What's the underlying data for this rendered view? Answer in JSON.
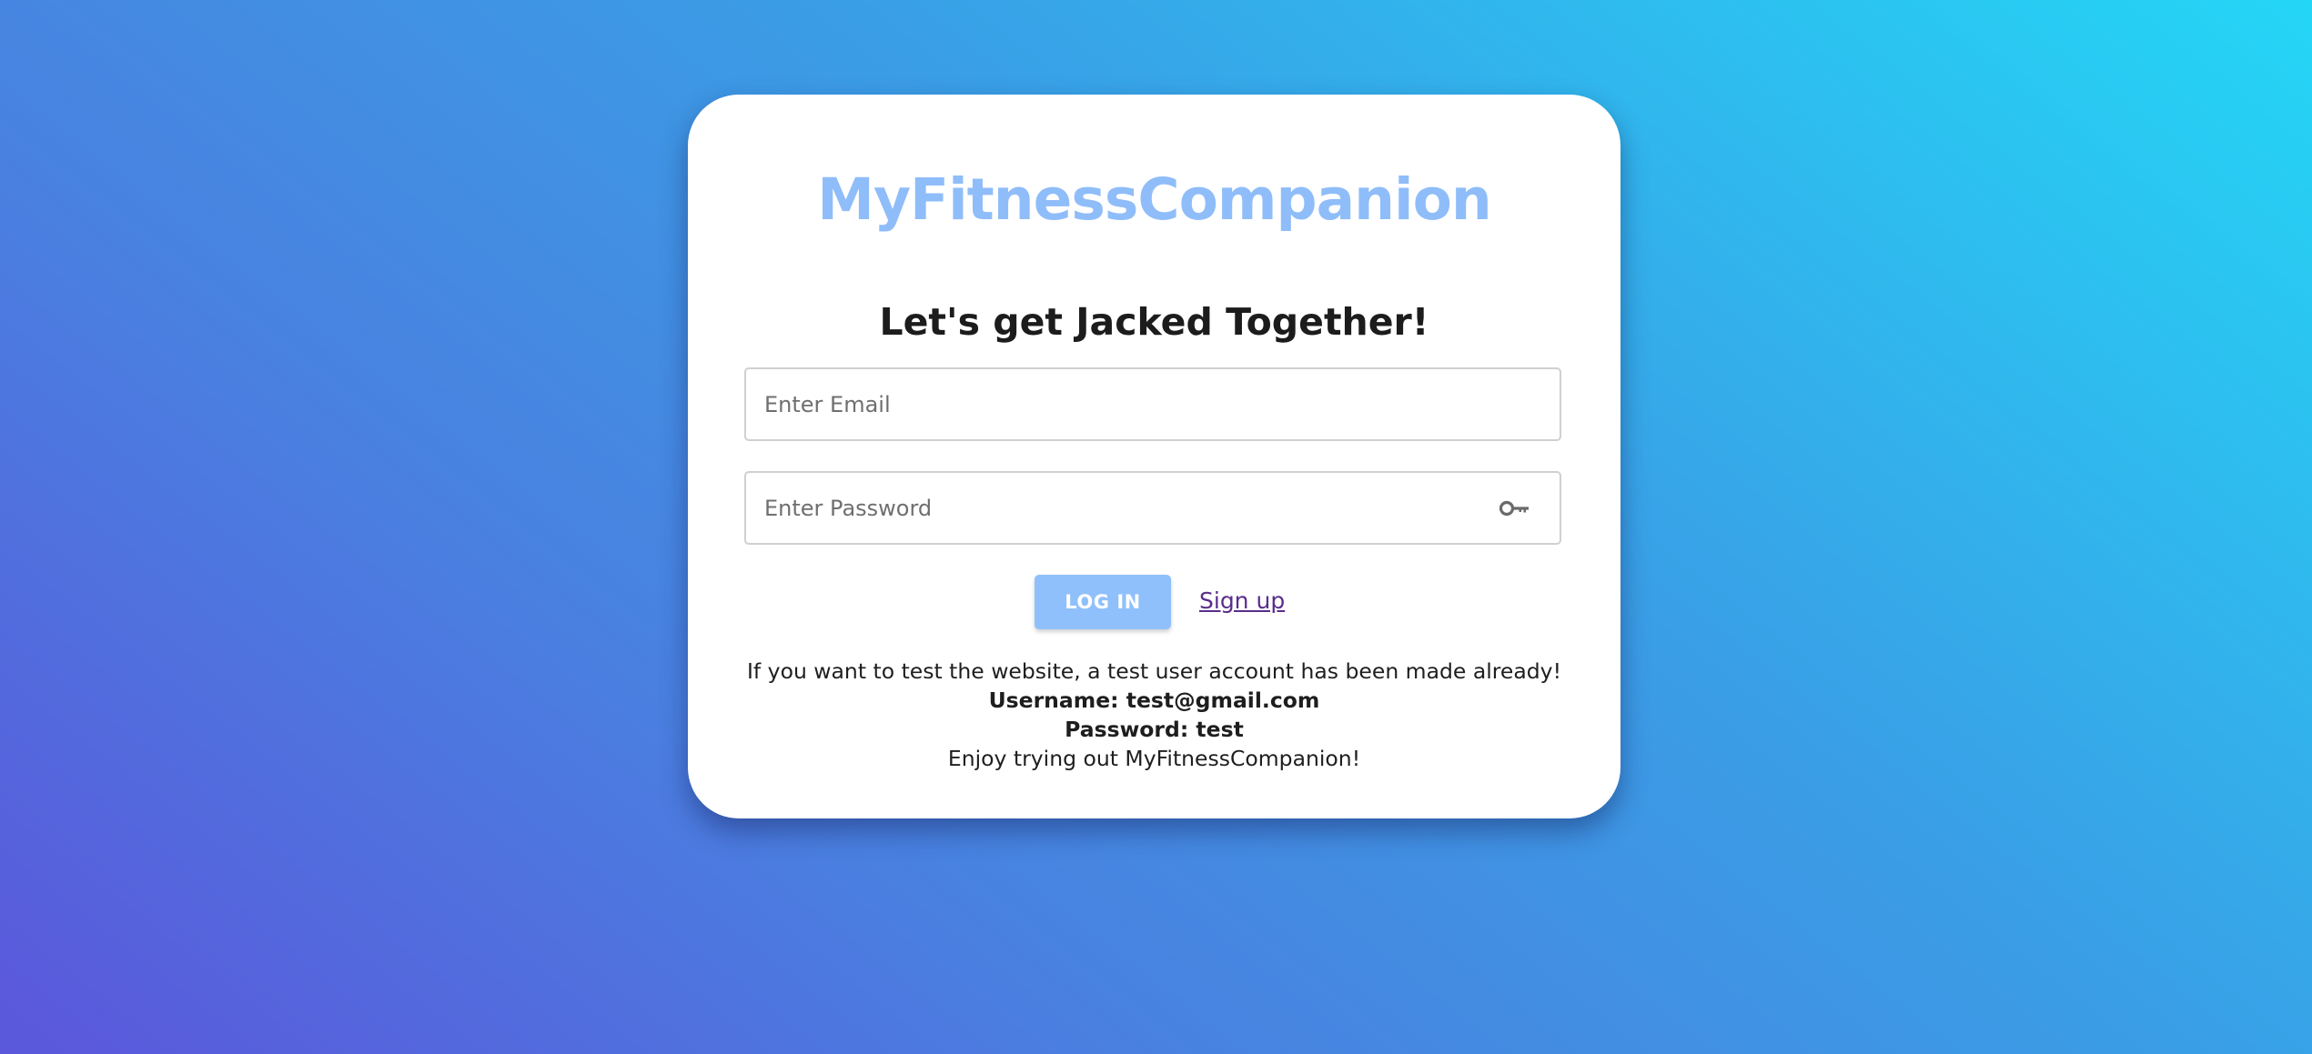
{
  "app": {
    "title": "MyFitnessCompanion",
    "tagline": "Let's get Jacked Together!"
  },
  "form": {
    "email_placeholder": "Enter Email",
    "password_placeholder": "Enter Password",
    "password_toggle_icon": "key-icon",
    "login_label": "LOG IN",
    "signup_label": "Sign up"
  },
  "info": {
    "line1": "If you want to test the website, a test user account has been made already!",
    "username_line": "Username: test@gmail.com",
    "password_line": "Password: test",
    "closing_line": "Enjoy trying out MyFitnessCompanion!"
  },
  "colors": {
    "accent": "#8fbdf9",
    "button": "#8fc0fb",
    "link": "#5a2d8a",
    "gradient_start": "#5b57db",
    "gradient_end": "#24d6f6"
  }
}
